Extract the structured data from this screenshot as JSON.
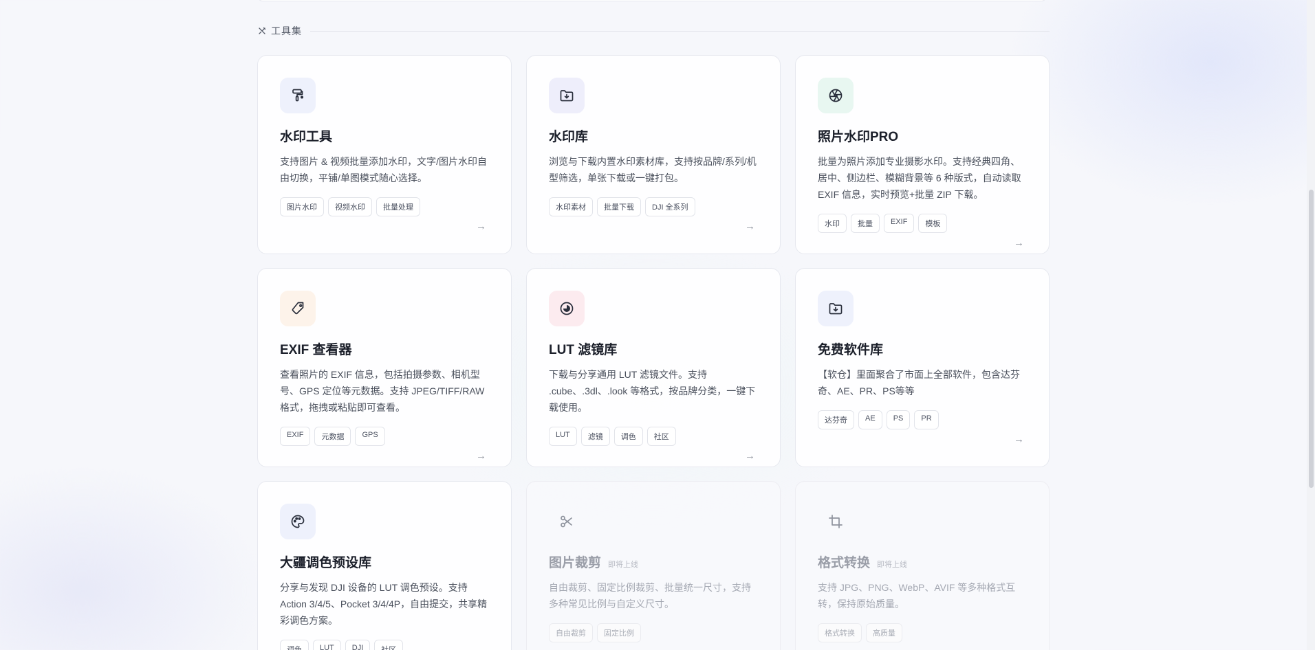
{
  "section": {
    "title": "工具集",
    "icon": "tools-icon"
  },
  "cards": [
    {
      "title": "水印工具",
      "desc": "支持图片 & 视频批量添加水印，文字/图片水印自由切换，平铺/单图模式随心选择。",
      "tags": [
        "图片水印",
        "视频水印",
        "批量处理"
      ],
      "icon": "paint-roller-icon",
      "icon_bg": "#eef1fc",
      "icon_color": "#2a2f3c",
      "arrow": "→"
    },
    {
      "title": "水印库",
      "desc": "浏览与下载内置水印素材库，支持按品牌/系列/机型筛选，单张下载或一键打包。",
      "tags": [
        "水印素材",
        "批量下载",
        "DJI 全系列"
      ],
      "icon": "folder-download-icon",
      "icon_bg": "#eeeefb",
      "icon_color": "#2a2f3c",
      "arrow": "→"
    },
    {
      "title": "照片水印PRO",
      "desc": "批量为照片添加专业摄影水印。支持经典四角、居中、侧边栏、模糊背景等 6 种版式，自动读取 EXIF 信息，实时预览+批量 ZIP 下载。",
      "tags": [
        "水印",
        "批量",
        "EXIF",
        "模板"
      ],
      "icon": "aperture-icon",
      "icon_bg": "#e8f7f1",
      "icon_color": "#2a2f3c",
      "arrow": "→"
    },
    {
      "title": "EXIF 查看器",
      "desc": "查看照片的 EXIF 信息，包括拍摄参数、相机型号、GPS 定位等元数据。支持 JPEG/TIFF/RAW 格式，拖拽或粘贴即可查看。",
      "tags": [
        "EXIF",
        "元数据",
        "GPS"
      ],
      "icon": "tag-icon",
      "icon_bg": "#fdf3ea",
      "icon_color": "#2a2f3c",
      "arrow": "→"
    },
    {
      "title": "LUT 滤镜库",
      "desc": "下载与分享通用 LUT 滤镜文件。支持 .cube、.3dl、.look 等格式，按品牌分类，一键下载使用。",
      "tags": [
        "LUT",
        "滤镜",
        "调色",
        "社区"
      ],
      "icon": "contrast-icon",
      "icon_bg": "#fcebef",
      "icon_color": "#2a2f3c",
      "arrow": "→"
    },
    {
      "title": "免费软件库",
      "desc": "【软仓】里面聚合了市面上全部软件，包含达芬奇、AE、PR、PS等等",
      "tags": [
        "达芬奇",
        "AE",
        "PS",
        "PR"
      ],
      "icon": "folder-download-icon",
      "icon_bg": "#eef1fc",
      "icon_color": "#2a2f3c",
      "arrow": "→"
    },
    {
      "title": "大疆调色预设库",
      "desc": "分享与发现 DJI 设备的 LUT 调色预设。支持 Action 3/4/5、Pocket 3/4/4P，自由提交，共享精彩调色方案。",
      "tags": [
        "调色",
        "LUT",
        "DJI",
        "社区"
      ],
      "icon": "palette-icon",
      "icon_bg": "#eef1fc",
      "icon_color": "#2a2f3c",
      "arrow": "→"
    },
    {
      "title": "图片裁剪",
      "badge": "即将上线",
      "desc": "自由裁剪、固定比例裁剪、批量统一尺寸，支持多种常见比例与自定义尺寸。",
      "tags": [
        "自由裁剪",
        "固定比例"
      ],
      "icon": "scissors-icon",
      "icon_bg": "transparent",
      "icon_color": "#8e939d",
      "arrow": "→",
      "disabled": true
    },
    {
      "title": "格式转换",
      "badge": "即将上线",
      "desc": "支持 JPG、PNG、WebP、AVIF 等多种格式互转，保持原始质量。",
      "tags": [
        "格式转换",
        "高质量"
      ],
      "icon": "crop-icon",
      "icon_bg": "transparent",
      "icon_color": "#8e939d",
      "arrow": "→",
      "disabled": true
    }
  ]
}
